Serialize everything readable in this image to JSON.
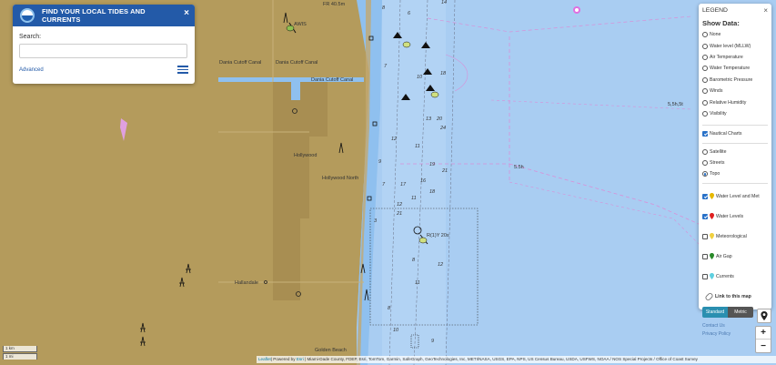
{
  "search_panel": {
    "title": "FIND YOUR LOCAL TIDES AND CURRENTS",
    "close": "×",
    "search_label": "Search:",
    "search_value": "",
    "advanced_link": "Advanced"
  },
  "legend": {
    "title": "LEGEND",
    "close": "×",
    "show_data_label": "Show Data:",
    "data_options": [
      {
        "label": "None",
        "selected": false
      },
      {
        "label": "Water level (MLLW)",
        "selected": false
      },
      {
        "label": "Air Temperature",
        "selected": false
      },
      {
        "label": "Water Temperature",
        "selected": false
      },
      {
        "label": "Barometric Pressure",
        "selected": false
      },
      {
        "label": "Winds",
        "selected": false
      },
      {
        "label": "Relative Humidity",
        "selected": false
      },
      {
        "label": "Visibility",
        "selected": false
      }
    ],
    "nautical_charts": {
      "label": "Nautical Charts",
      "checked": true
    },
    "base_layers": [
      {
        "label": "Satellite",
        "selected": false
      },
      {
        "label": "Streets",
        "selected": false
      },
      {
        "label": "Topo",
        "selected": true
      }
    ],
    "station_layers": [
      {
        "label": "Water Level and Met",
        "checked": true,
        "pin_color": "#e6b800"
      },
      {
        "label": "Water Levels",
        "checked": true,
        "pin_color": "#e02020"
      },
      {
        "label": "Meteorological",
        "checked": false,
        "pin_color": "#f0d040"
      },
      {
        "label": "Air Gap",
        "checked": false,
        "pin_color": "#2a8a2a"
      },
      {
        "label": "Currents",
        "checked": false,
        "pin_color": "#5fd0e0"
      }
    ],
    "link_to_map": "Link to this map",
    "unit_standard": "Standard",
    "unit_metric": "Metric",
    "contact_us": "Contact Us",
    "privacy_policy": "Privacy Policy"
  },
  "map": {
    "zoom_in": "+",
    "zoom_out": "−",
    "scale_km": "1 km",
    "scale_mi": "1 mi",
    "place_labels": {
      "dania_canal_1": "Dania Cutoff Canal",
      "dania_canal_2": "Dania Cutoff Canal",
      "dania_canal_3": "Dania Cutoff Canal",
      "hollywood": "Hollywood",
      "hollywood_north": "Hollywood North",
      "hallandale": "Hallandale",
      "golden_beach": "Golden Beach",
      "fr_light": "FR 40.5m",
      "awis": "AWIS",
      "rq_light": "R(1)Y 20s",
      "depth_ss": "5,5h,5t",
      "depth_5s": "5.5h"
    },
    "depths": [
      "8",
      "6",
      "14",
      "7",
      "10",
      "18",
      "13",
      "20",
      "24",
      "12",
      "11",
      "9",
      "19",
      "21",
      "16",
      "17",
      "7",
      "11",
      "12",
      "18",
      "21",
      "3",
      "8",
      "12",
      "11",
      "8",
      "10",
      "9"
    ],
    "attribution": {
      "leaflet": "Leaflet",
      "powered_by": "| Powered by ",
      "esri": "Esri",
      "sources": " | Miami-Dade County, FDEP, Esri, TomTom, Garmin, SafeGraph, GeoTechnologies, Inc, METI/NASA, USGS, EPA, NPS, US Census Bureau, USDA, USFWS, NOAA / NOS Special Projects / Office of Coast Survey"
    }
  },
  "colors": {
    "header_blue": "#235aa8",
    "land": "#b49b5c",
    "land_dark": "#a88e52",
    "water": "#a9cdf2",
    "water_shallow": "#8fc0ef",
    "magenta": "#d890d8",
    "toggle_standard": "#2a8fb0"
  }
}
